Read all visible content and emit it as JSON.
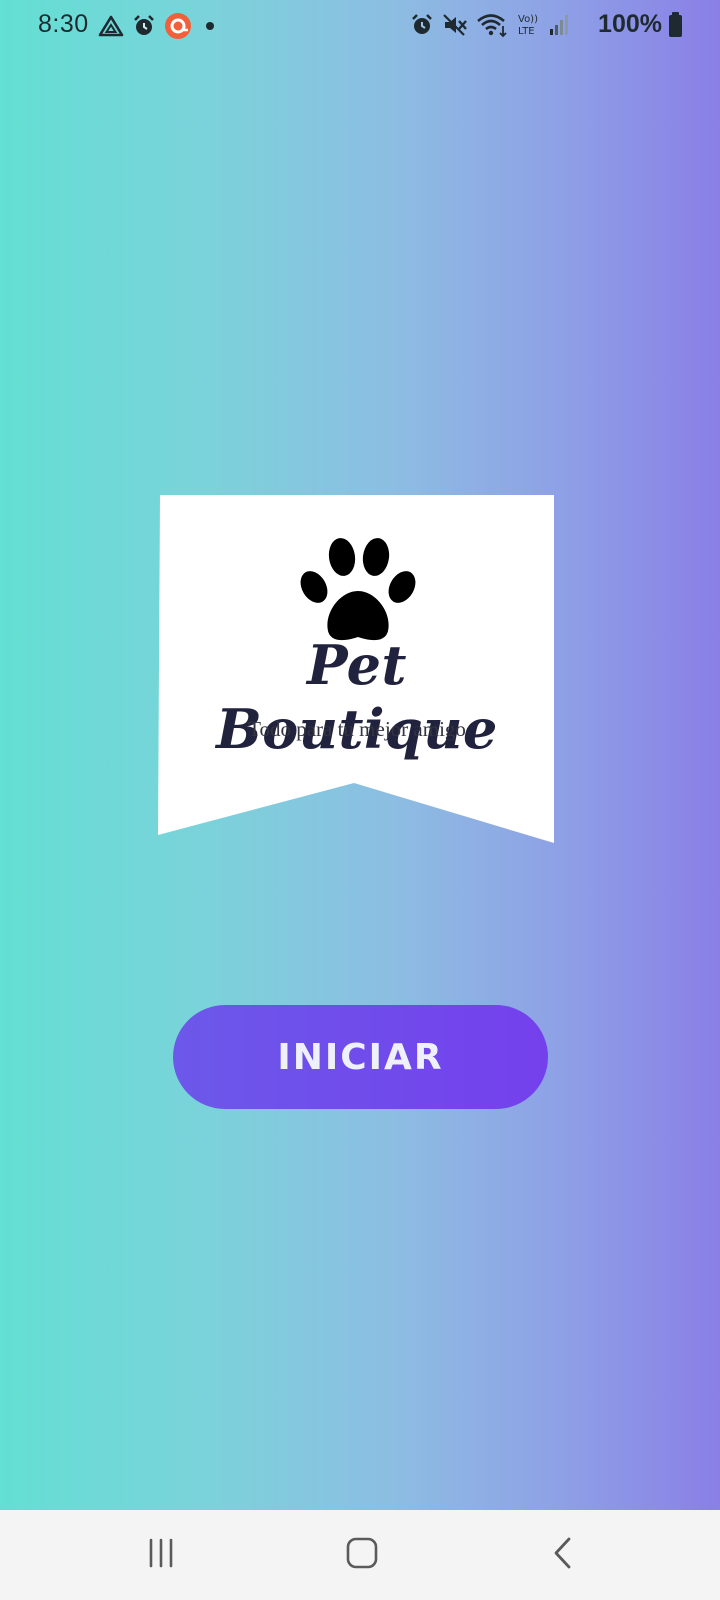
{
  "status_bar": {
    "time": "8:30",
    "battery_percent": "100%",
    "left_icons": [
      "drive-icon",
      "alarm-icon",
      "app-notification-icon",
      "dot-icon"
    ],
    "right_icons": [
      "alarm-icon",
      "mute-icon",
      "wifi-icon",
      "volte-icon",
      "signal-icon",
      "battery-icon"
    ]
  },
  "logo": {
    "brand_name": "Pet Boutique",
    "tagline": "Todo para tu mejor amigo",
    "icon": "paw-icon"
  },
  "actions": {
    "start_label": "INICIAR"
  },
  "nav_bar": {
    "items": [
      "recent-apps-icon",
      "home-icon",
      "back-icon"
    ]
  },
  "colors": {
    "gradient_left": "#63dfd3",
    "gradient_right": "#8a7fe6",
    "button": "#7048eb",
    "brand_text": "#21223d"
  }
}
